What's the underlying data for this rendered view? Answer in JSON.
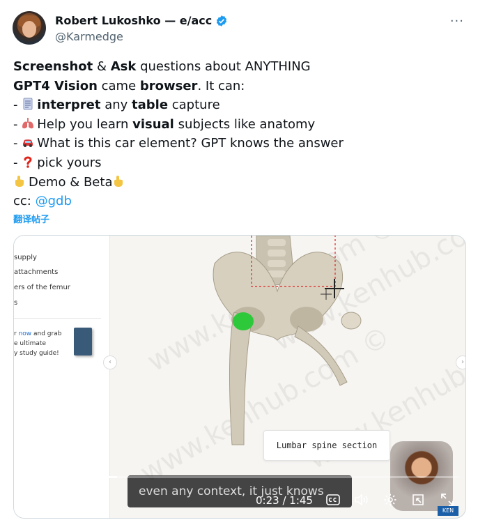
{
  "author": {
    "name": "Robert Lukoshko — e/acc",
    "handle": "@Karmedge",
    "verified_color": "#1d9bf0"
  },
  "more_label": "···",
  "tweet": {
    "lines": [
      {
        "parts": [
          {
            "t": "Screenshot",
            "b": true
          },
          {
            "t": " & ",
            "b": false
          },
          {
            "t": "Ask",
            "b": true
          },
          {
            "t": " questions about ANYTHING",
            "b": false
          }
        ]
      },
      {
        "parts": [
          {
            "t": "GPT4 Vision",
            "b": true
          },
          {
            "t": " came ",
            "b": false
          },
          {
            "t": "browser",
            "b": true
          },
          {
            "t": ". It can:",
            "b": false
          }
        ]
      },
      {
        "icon": "page-facing-up-icon",
        "parts": [
          {
            "t": "- ",
            "b": false
          },
          {
            "t": "interpret",
            "b": true
          },
          {
            "t": " any ",
            "b": false
          },
          {
            "t": "table",
            "b": true
          },
          {
            "t": " capture",
            "b": false
          }
        ]
      },
      {
        "icon": "lungs-icon",
        "parts": [
          {
            "t": "- ",
            "b": false
          },
          {
            "t": "Help you learn ",
            "b": false
          },
          {
            "t": "visual",
            "b": true
          },
          {
            "t": " subjects like anatomy",
            "b": false
          }
        ]
      },
      {
        "icon": "car-icon",
        "parts": [
          {
            "t": "- ",
            "b": false
          },
          {
            "t": "What is this car element?  GPT knows the answer",
            "b": false
          }
        ]
      },
      {
        "icon": "question-mark-icon",
        "parts": [
          {
            "t": "- ",
            "b": false
          },
          {
            "t": "pick yours",
            "b": false
          }
        ]
      },
      {
        "icon": "pointing-down-icon",
        "parts": [
          {
            "t": "Demo & Beta",
            "b": false
          }
        ]
      },
      {
        "parts": [
          {
            "t": "cc: ",
            "b": false
          },
          {
            "t": "@gdb",
            "b": false,
            "link": true
          }
        ]
      }
    ],
    "translate_label": "翻译帖子"
  },
  "media": {
    "sidebar_items": [
      "supply",
      " attachments",
      "ers of the femur",
      "s"
    ],
    "sidebar_cta_prefix": "r ",
    "sidebar_cta_link": "now",
    "sidebar_cta_rest": " and grab",
    "sidebar_cta_line2": "e ultimate",
    "sidebar_cta_line3": "y study guide!",
    "caption": "Lumbar spine section",
    "watermark": "www.kenhub.com ©",
    "subtitle": "even any context, it just knows",
    "time": "0:23 / 1:45",
    "progress": 0.22,
    "badge": "KEN",
    "highlight_color": "#2ec93a"
  }
}
